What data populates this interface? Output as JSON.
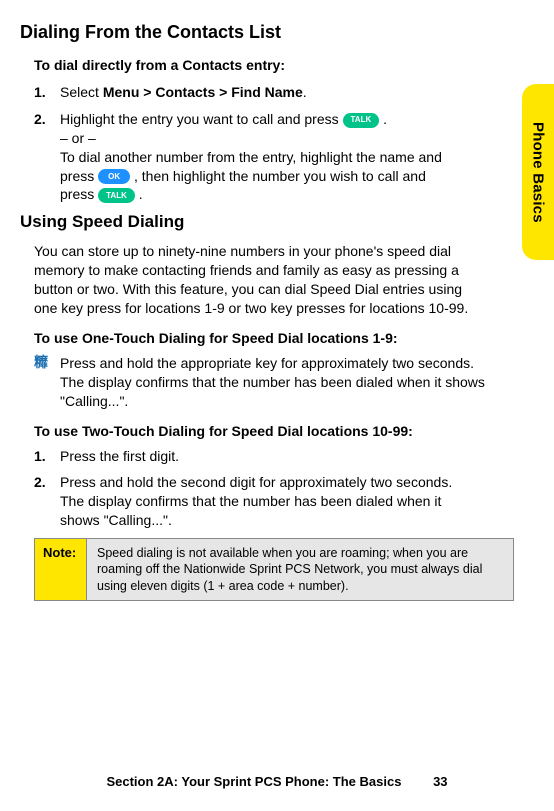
{
  "sideTab": "Phone Basics",
  "title": "Dialing From the Contacts List",
  "lead1": "To dial directly from a Contacts entry:",
  "step1": {
    "num": "1.",
    "pre": "Select ",
    "b1": "Menu",
    "g1": " > ",
    "b2": "Contacts",
    "g2": " > ",
    "b3": "Find Name",
    "post": "."
  },
  "step2": {
    "num": "2.",
    "l1a": "Highlight the entry you want to call and press ",
    "l1b": ".",
    "l2": "– or –",
    "l3a": "To dial another number from the entry, highlight the name and press ",
    "l3b": ", then highlight the number you wish to call and press ",
    "l3c": "."
  },
  "pill_talk": "TALK",
  "pill_ok": "OK",
  "subhead": "Using Speed Dialing",
  "para1": "You can store up to ninety-nine numbers in your phone's speed dial memory to make contacting friends and family as easy as pressing a button or two. With this feature, you can dial Speed Dial entries using one key press for locations 1-9 or two key presses for locations 10-99.",
  "lead2": "To use One-Touch Dialing for Speed Dial locations 1-9:",
  "bullet1": "Press and hold the appropriate key for approximately two seconds. The display confirms that the number has been dialed when it shows \"Calling...\".",
  "lead3": "To use Two-Touch Dialing for Speed Dial locations 10-99:",
  "step3": {
    "num": "1.",
    "text": "Press the first digit."
  },
  "step4": {
    "num": "2.",
    "text": "Press and hold the second digit for approximately two seconds. The display confirms that the number has been dialed when it shows \"Calling...\"."
  },
  "note": {
    "label": "Note:",
    "body": "Speed dialing is not available when you are roaming; when you are roaming off the Nationwide Sprint PCS Network, you must always dial using eleven digits (1 + area code + number)."
  },
  "footer": {
    "section": "Section 2A: Your Sprint PCS Phone: The Basics",
    "page": "33"
  }
}
